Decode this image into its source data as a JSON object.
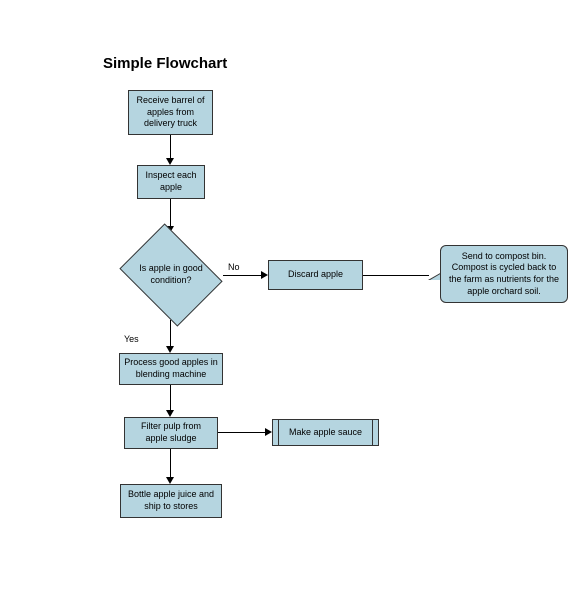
{
  "title": "Simple Flowchart",
  "nodes": {
    "receive": "Receive barrel of apples from delivery truck",
    "inspect": "Inspect each apple",
    "decision": "Is apple in good condition?",
    "discard": "Discard apple",
    "compost": "Send to compost bin. Compost is cycled back to the farm as nutrients for the apple orchard soil.",
    "process": "Process good apples in blending machine",
    "filter": "Filter pulp from apple sludge",
    "sauce": "Make apple sauce",
    "bottle": "Bottle apple juice and ship to stores"
  },
  "edges": {
    "no": "No",
    "yes": "Yes"
  }
}
